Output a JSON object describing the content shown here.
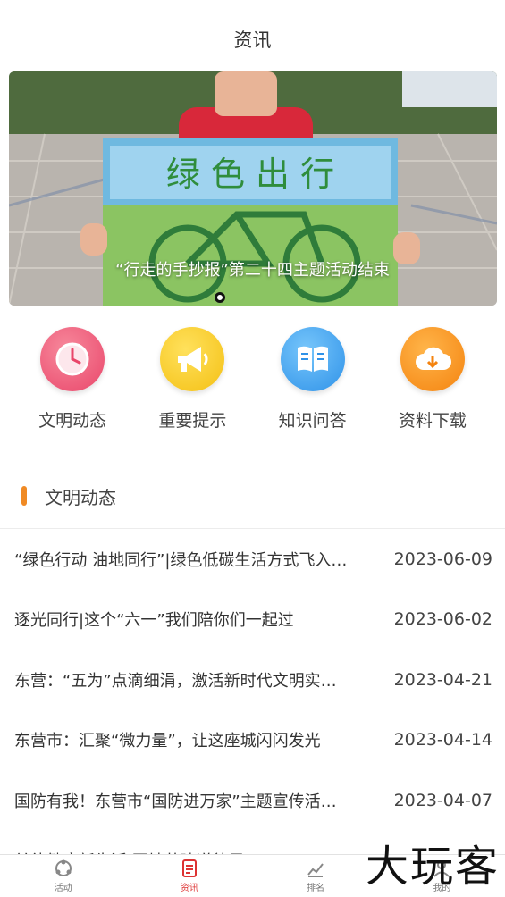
{
  "header": {
    "title": "资讯"
  },
  "banner": {
    "caption": "“行走的手抄报”第二十四主题活动结束",
    "poster_text": "绿 色 出 行",
    "active_slide": 1
  },
  "quick_links": [
    {
      "label": "文明动态",
      "icon": "clock-icon",
      "color": "#ef5d78"
    },
    {
      "label": "重要提示",
      "icon": "megaphone-icon",
      "color": "#f6c825"
    },
    {
      "label": "知识问答",
      "icon": "book-icon",
      "color": "#3ea2ef"
    },
    {
      "label": "资料下载",
      "icon": "cloud-download-icon",
      "color": "#f6921e"
    }
  ],
  "section": {
    "title": "文明动态",
    "accent": "#f08a24"
  },
  "news": [
    {
      "title": "“绿色行动 油地同行”|绿色低碳生活方式飞入…",
      "date": "2023-06-09"
    },
    {
      "title": "逐光同行|这个“六一”我们陪你们一起过",
      "date": "2023-06-02"
    },
    {
      "title": "东营：“五为”点滴细涓，激活新时代文明实…",
      "date": "2023-04-21"
    },
    {
      "title": "东营市：汇聚“微力量”，让这座城闪闪发光",
      "date": "2023-04-14"
    },
    {
      "title": "国防有我！东营市“国防进万家”主题宣传活…",
      "date": "2023-04-07"
    },
    {
      "title": "关律健康新生活 同地共建道德风",
      "date": ""
    }
  ],
  "tabbar": [
    {
      "label": "活动",
      "icon": "activity-icon",
      "active": false
    },
    {
      "label": "资讯",
      "icon": "news-icon",
      "active": true
    },
    {
      "label": "排名",
      "icon": "ranking-icon",
      "active": false
    },
    {
      "label": "我的",
      "icon": "profile-icon",
      "active": false
    }
  ],
  "watermark": "大玩客"
}
